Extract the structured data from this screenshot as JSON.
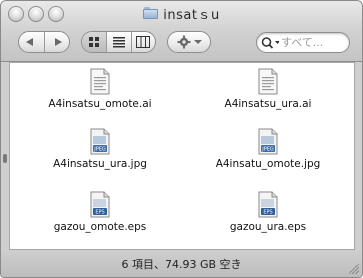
{
  "window": {
    "title": "insatｓu"
  },
  "toolbar": {
    "back_icon": "chevron-left-icon",
    "forward_icon": "chevron-right-icon",
    "view_icon_view": "grid-icon",
    "view_list": "list-icon",
    "view_columns": "columns-icon",
    "action_icon": "gear-icon",
    "action_menu_icon": "chevron-down-icon"
  },
  "search": {
    "placeholder": "すべて..."
  },
  "files": [
    {
      "name": "A4insatsu_omote.ai",
      "kind": "ai-document-icon"
    },
    {
      "name": "A4insatsu_ura.ai",
      "kind": "ai-document-icon"
    },
    {
      "name": "A4insatsu_ura.jpg",
      "kind": "jpeg-icon",
      "badge": "JPEG"
    },
    {
      "name": "A4insatu_omote.jpg",
      "kind": "jpeg-icon",
      "badge": "JPEG"
    },
    {
      "name": "gazou_omote.eps",
      "kind": "eps-icon",
      "badge": "EPS"
    },
    {
      "name": "gazou_ura.eps",
      "kind": "eps-icon",
      "badge": "EPS"
    }
  ],
  "status": {
    "text": "6 項目、74.93 GB 空き"
  },
  "colors": {
    "window_chrome": "#cfcfcf",
    "content_background": "#ffffff",
    "folder_blue": "#98b4d6"
  }
}
